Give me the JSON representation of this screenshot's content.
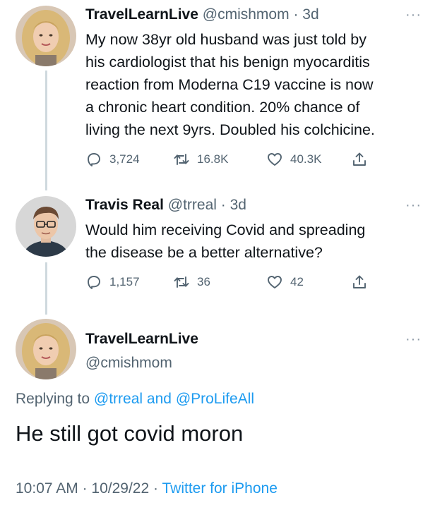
{
  "tweets": [
    {
      "name": "TravelLearnLive",
      "handle": "@cmishmom",
      "sep": "·",
      "time": "3d",
      "more": "···",
      "lines": [
        "My now 38yr old husband was just told by",
        "his cardiologist that his benign myocarditis",
        "reaction from Moderna C19 vaccine is now",
        "a chronic heart condition. 20% chance of",
        "living the next 9yrs. Doubled his colchicine."
      ],
      "replies": "3,724",
      "retweets": "16.8K",
      "likes": "40.3K"
    },
    {
      "name": "Travis Real",
      "handle": "@trreal",
      "sep": "·",
      "time": "3d",
      "more": "···",
      "lines": [
        "Would him receiving Covid and spreading",
        "the disease be a better alternative?"
      ],
      "replies": "1,157",
      "retweets": "36",
      "likes": "42"
    }
  ],
  "main": {
    "name": "TravelLearnLive",
    "handle": "@cmishmom",
    "more": "···",
    "replying_prefix": "Replying to",
    "mention1": "@trreal",
    "and": "and",
    "mention2": "@ProLifeAll",
    "text": "He still got covid moron",
    "time": "10:07 AM",
    "sep": "·",
    "date": "10/29/22",
    "source": "Twitter for iPhone"
  },
  "colors": {
    "text": "#0f1419",
    "secondary": "#536471",
    "link": "#1d9bf0",
    "thread_line": "#cfd9de"
  },
  "icons": [
    "reply-icon",
    "retweet-icon",
    "like-icon",
    "share-icon",
    "more-icon"
  ]
}
